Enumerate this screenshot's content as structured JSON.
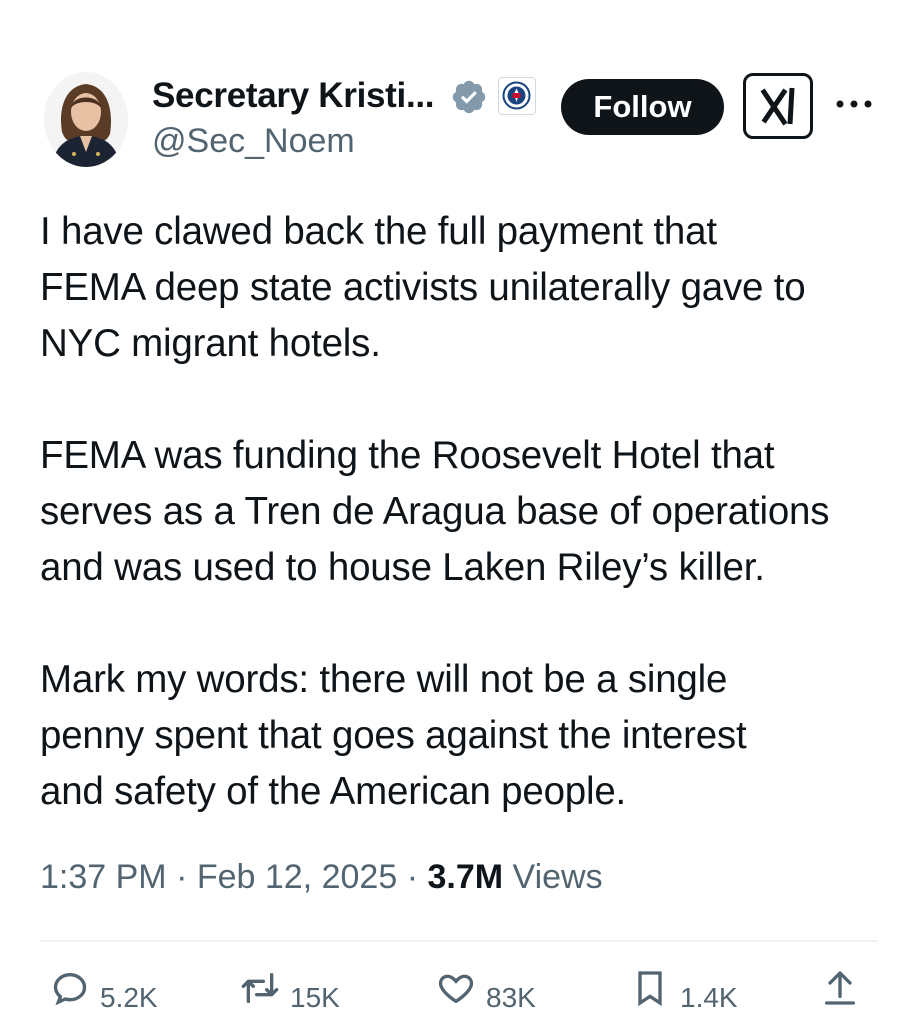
{
  "author": {
    "name": "Secretary Kristi...",
    "handle": "@Sec_Noem",
    "verified_color": "#829aab"
  },
  "header": {
    "follow_label": "Follow",
    "grok_icon": "grok-icon",
    "more_icon": "more-icon"
  },
  "tweet": {
    "paragraphs": [
      [
        "I have clawed back the full payment that",
        "FEMA deep state activists unilaterally gave to",
        "NYC migrant hotels."
      ],
      [
        "FEMA was funding the Roosevelt Hotel that",
        "serves as a Tren de Aragua base of operations",
        "and was used to house Laken Riley’s killer."
      ],
      [
        "Mark my words: there will not be a single",
        "penny spent that goes against the interest",
        "and safety of the American people."
      ]
    ],
    "time": "1:37 PM",
    "date": "Feb 12, 2025",
    "views_count": "3.7M",
    "views_label": "Views"
  },
  "actions": {
    "reply_count": "5.2K",
    "repost_count": "15K",
    "like_count": "83K",
    "bookmark_count": "1.4K"
  },
  "colors": {
    "text": "#0f1419",
    "secondary": "#536471",
    "divider": "#eff3f4"
  }
}
